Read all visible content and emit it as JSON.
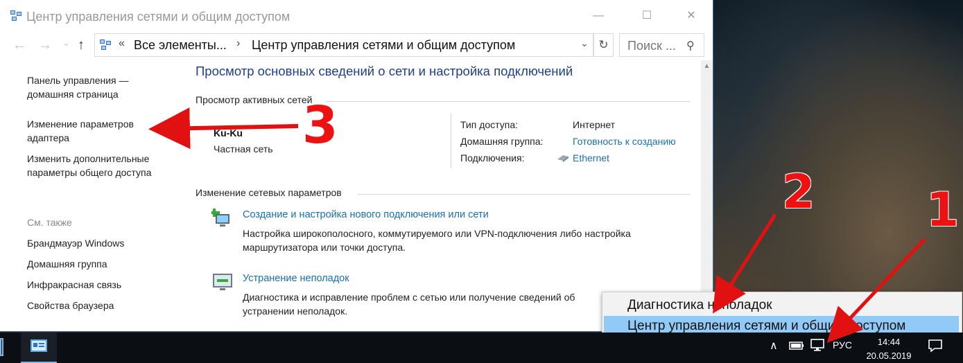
{
  "window": {
    "title": "Центр управления сетями и общим доступом",
    "minimize": "—",
    "maximize": "☐",
    "close": "✕"
  },
  "nav": {
    "back": "←",
    "forward": "→",
    "dropdown": "⌄",
    "up": "↑",
    "breadcrumb_sep": "«",
    "crumb1": "Все элементы...",
    "crumb_sep2": "›",
    "crumb2": "Центр управления сетями и общим доступом",
    "addr_dropdown": "⌄",
    "refresh": "↻",
    "search_placeholder": "Поиск ...",
    "search_icon": "⚲"
  },
  "left_pane": {
    "home_line1": "Панель управления —",
    "home_line2": "домашняя страница",
    "adapter_line1": "Изменение параметров",
    "adapter_line2": "адаптера",
    "sharing_line1": "Изменить дополнительные",
    "sharing_line2": "параметры общего доступа",
    "see_also": "См. также",
    "firewall": "Брандмауэр Windows",
    "homegroup": "Домашняя группа",
    "infrared": "Инфракрасная связь",
    "browser": "Свойства браузера"
  },
  "main": {
    "title": "Просмотр основных сведений о сети и настройка подключений",
    "active_networks_header": "Просмотр активных сетей",
    "network_name": "Ku-Ku",
    "network_type": "Частная сеть",
    "access_type_label": "Тип доступа:",
    "access_type_value": "Интернет",
    "homegroup_label": "Домашняя группа:",
    "homegroup_value": "Готовность к созданию",
    "connections_label": "Подключения:",
    "connections_value": "Ethernet",
    "change_settings_header": "Изменение сетевых параметров",
    "task1_link": "Создание и настройка нового подключения или сети",
    "task1_desc": "Настройка широкополосного, коммутируемого или VPN-подключения либо настройка маршрутизатора или точки доступа.",
    "task2_link": "Устранение неполадок",
    "task2_desc": "Диагностика и исправление проблем с сетью или получение сведений об устранении неполадок."
  },
  "context_menu": {
    "item1": "Диагностика неполадок",
    "item2": "Центр управления сетями и общим доступом"
  },
  "taskbar": {
    "tray_chevron": "∧",
    "language": "РУС",
    "time": "14:44",
    "date": "20.05.2019"
  },
  "annotations": {
    "n1": "1",
    "n2": "2",
    "n3": "3"
  },
  "colors": {
    "link": "#1a6fad",
    "title_blue": "#1e3f8a",
    "menu_highlight": "#91c9f7",
    "annotation_red": "#e11111"
  }
}
